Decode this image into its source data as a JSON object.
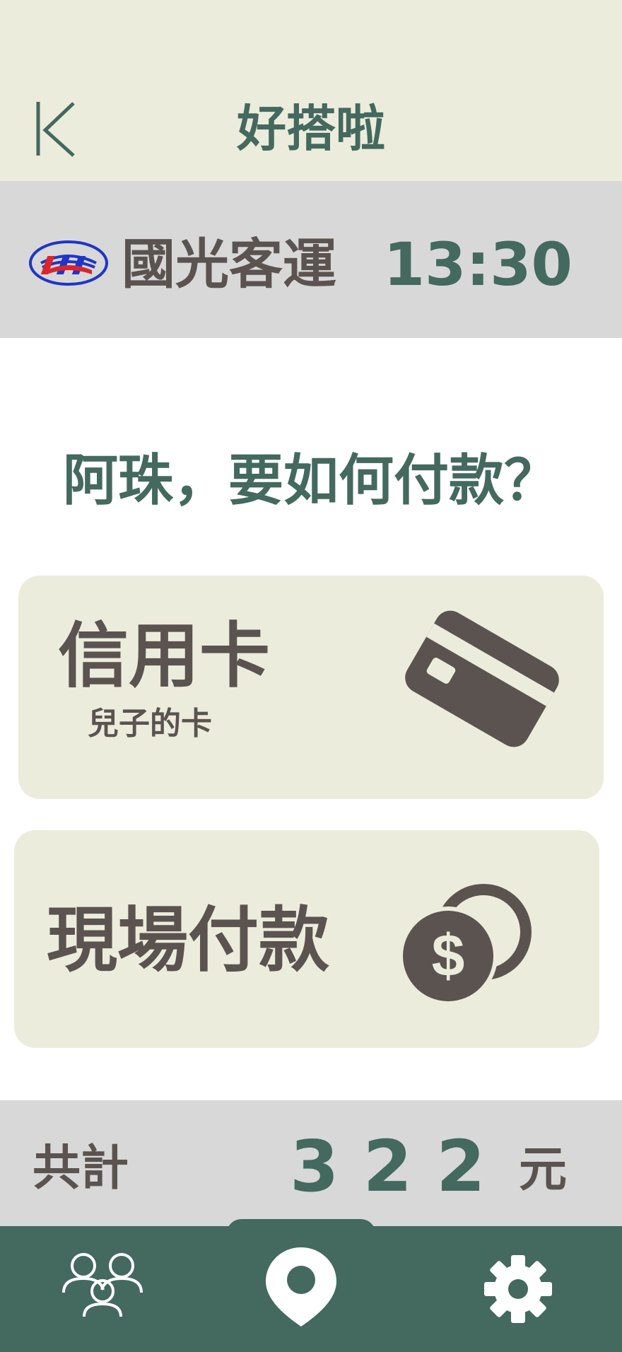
{
  "header": {
    "title": "好搭啦",
    "back_icon": "back-chevron-icon"
  },
  "operator": {
    "name": "國光客運",
    "time": "13:30",
    "logo_icon": "kuo-kuang-logo"
  },
  "payment": {
    "question": "阿珠，要如何付款？",
    "options": [
      {
        "label": "信用卡",
        "sublabel": "兒子的卡",
        "icon": "credit-card-icon"
      },
      {
        "label": "現場付款",
        "icon": "coins-dollar-icon"
      }
    ]
  },
  "total": {
    "label": "共計",
    "amount": "322",
    "unit": "元"
  },
  "nav": {
    "items": [
      {
        "icon": "friends-icon"
      },
      {
        "icon": "location-pin-icon",
        "active": true
      },
      {
        "icon": "gear-icon"
      }
    ]
  },
  "colors": {
    "primary_green": "#44695E",
    "header_bg": "#ECECDD",
    "bar_bg": "#D8D8D8",
    "text_brown": "#5B5350",
    "nav_icon": "#FFFFFF"
  }
}
